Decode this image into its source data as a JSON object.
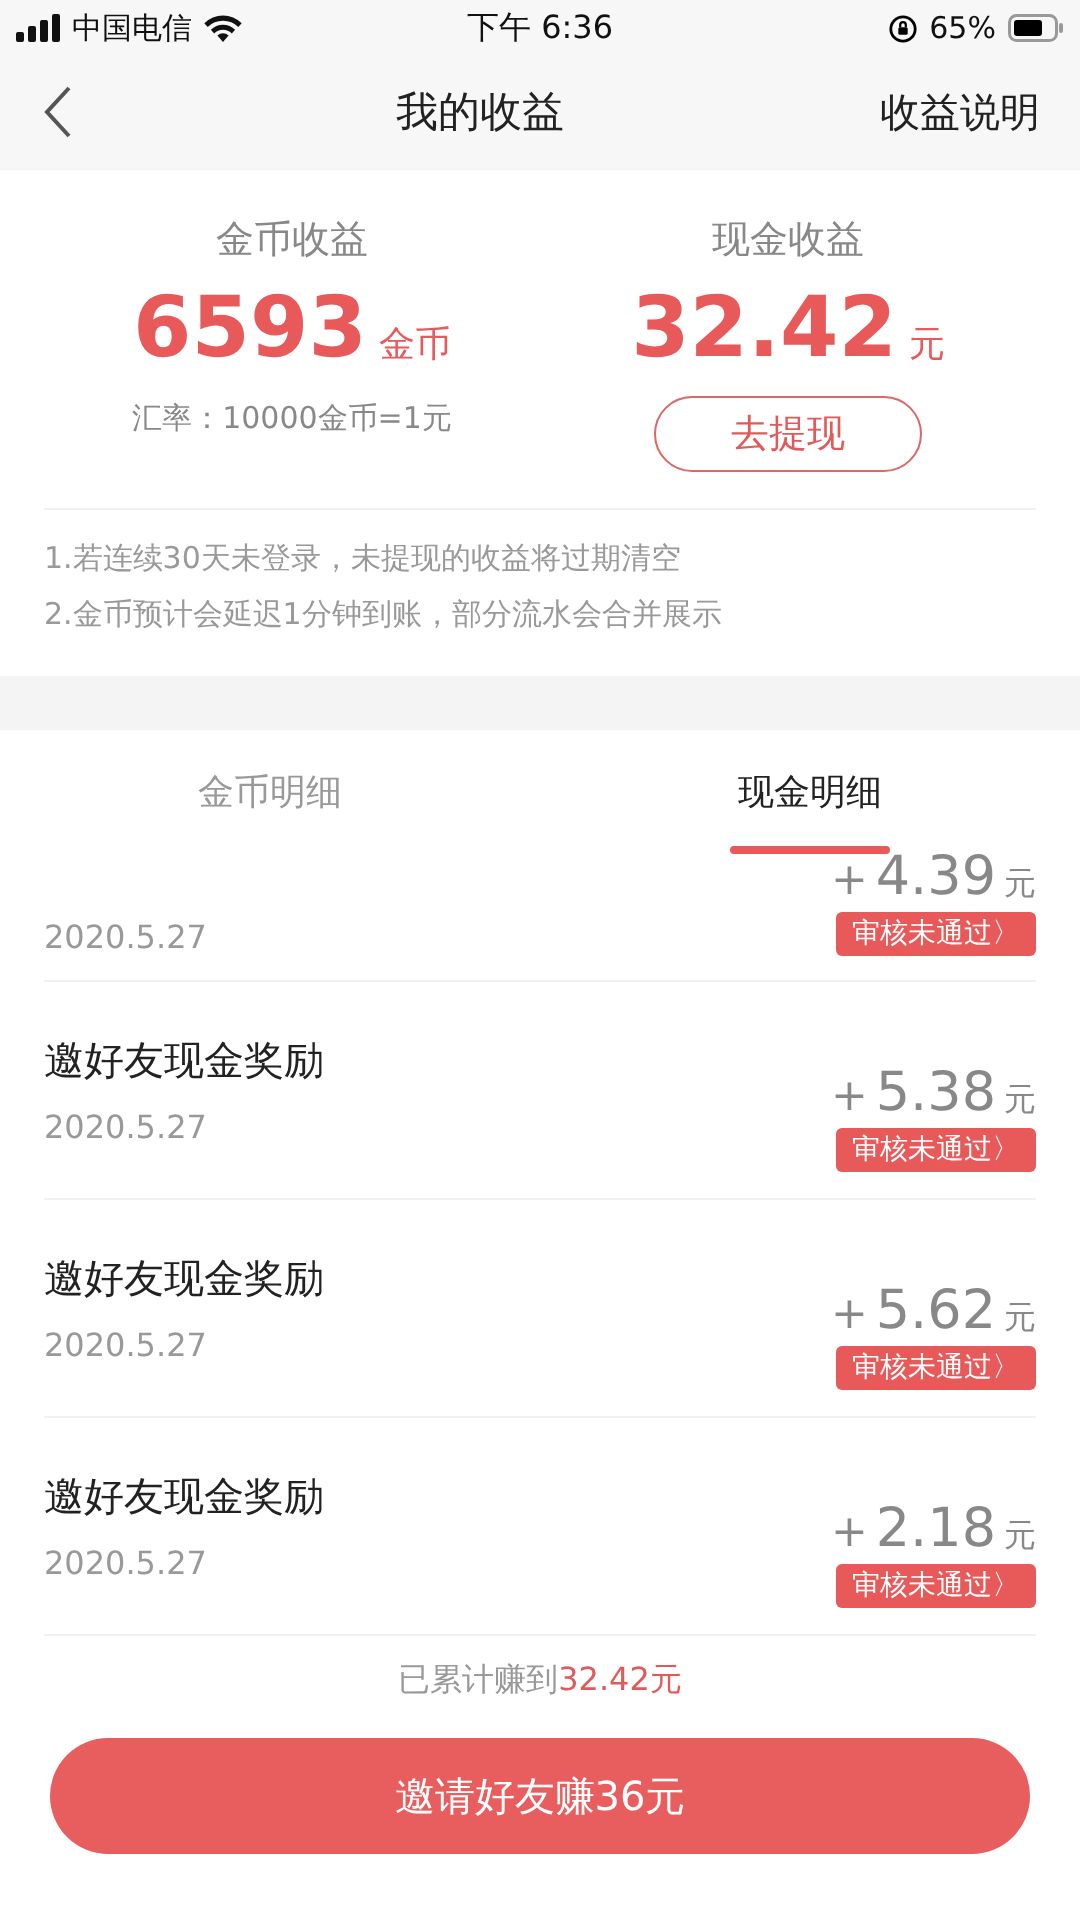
{
  "status_bar": {
    "carrier": "中国电信",
    "time": "下午 6:36",
    "battery": "65%"
  },
  "nav": {
    "title": "我的收益",
    "action": "收益说明"
  },
  "summary": [
    {
      "kind": "coins",
      "label": "金币收益",
      "value": "6593",
      "unit": "金币",
      "note": "汇率：10000金币=1元"
    },
    {
      "kind": "cash",
      "label": "现金收益",
      "value": "32.42",
      "unit": "元",
      "button": "去提现"
    }
  ],
  "notices": [
    "1.若连续30天未登录，未提现的收益将过期清空",
    "2.金币预计会延迟1分钟到账，部分流水会合并展示"
  ],
  "tabs": [
    {
      "label": "金币明细",
      "selected": false
    },
    {
      "label": "现金明细",
      "selected": true
    }
  ],
  "records": [
    {
      "date": "2020.5.27",
      "sign": "+",
      "amount": "4.39",
      "unit": "元",
      "status": "审核未通过〉"
    },
    {
      "title": "邀好友现金奖励",
      "date": "2020.5.27",
      "sign": "+",
      "amount": "5.38",
      "unit": "元",
      "status": "审核未通过〉"
    },
    {
      "title": "邀好友现金奖励",
      "date": "2020.5.27",
      "sign": "+",
      "amount": "5.62",
      "unit": "元",
      "status": "审核未通过〉"
    },
    {
      "title": "邀好友现金奖励",
      "date": "2020.5.27",
      "sign": "+",
      "amount": "2.18",
      "unit": "元",
      "status": "审核未通过〉"
    }
  ],
  "footer": {
    "total_label": "已累计赚到",
    "total_value": "32.42元",
    "invite_button": "邀请好友赚36元"
  }
}
